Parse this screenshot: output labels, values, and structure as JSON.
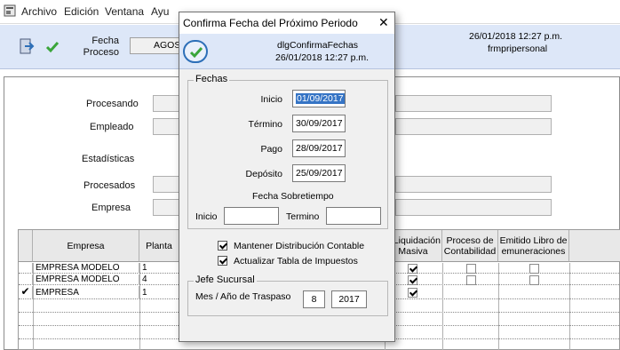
{
  "menubar": {
    "items": [
      "Archivo",
      "Edición",
      "Ventana",
      "Ayu"
    ]
  },
  "toolbar": {
    "fecha_label": "Fecha",
    "proceso_label": "Proceso",
    "fecha_value": "AGOST",
    "datetime": "26/01/2018 12:27 p.m.",
    "form_name": "frmpripersonal"
  },
  "form": {
    "procesando_label": "Procesando",
    "empleado_label": "Empleado",
    "estadisticas_label": "Estadísticas",
    "procesados_label": "Procesados",
    "empresa_label": "Empresa"
  },
  "grid": {
    "columns": [
      "Empresa",
      "Planta",
      "o Liquidación Masiva",
      "Proceso de Contabilidad",
      "Emitido Libro de emuneraciones"
    ],
    "rows": [
      {
        "selected": false,
        "empresa": "EMPRESA MODELO",
        "planta": "1",
        "liquidacion": true,
        "contabilidad": false,
        "libro": false
      },
      {
        "selected": false,
        "empresa": "EMPRESA MODELO",
        "planta": "4",
        "liquidacion": true,
        "contabilidad": false,
        "libro": false
      },
      {
        "selected": true,
        "empresa": "EMPRESA",
        "planta": "1",
        "liquidacion": true,
        "contabilidad": false,
        "libro": false
      }
    ]
  },
  "dialog": {
    "title": "Confirma Fecha del Próximo Periodo",
    "close_glyph": "✕",
    "header_name": "dlgConfirmaFechas",
    "header_datetime": "26/01/2018 12:27 p.m.",
    "fechas": {
      "group_title": "Fechas",
      "inicio_label": "Inicio",
      "inicio_value": "01/09/2017",
      "termino_label": "Término",
      "termino_value": "30/09/2017",
      "pago_label": "Pago",
      "pago_value": "28/09/2017",
      "deposito_label": "Depósito",
      "deposito_value": "25/09/2017",
      "sobretiempo_label": "Fecha Sobretiempo",
      "st_inicio_label": "Inicio",
      "st_inicio_value": "",
      "st_termino_label": "Termino",
      "st_termino_value": ""
    },
    "checks": {
      "mantener_label": "Mantener Distribución Contable",
      "mantener_checked": true,
      "actualizar_label": "Actualizar Tabla de Impuestos",
      "actualizar_checked": true
    },
    "jefe": {
      "group_title": "Jefe Sucursal",
      "traspaso_label": "Mes / Año de Traspaso",
      "mes_value": "8",
      "anio_value": "2017"
    }
  },
  "colors": {
    "header_bg": "#dde7f8",
    "selection": "#3574c5",
    "accent_green": "#3aa53a"
  }
}
